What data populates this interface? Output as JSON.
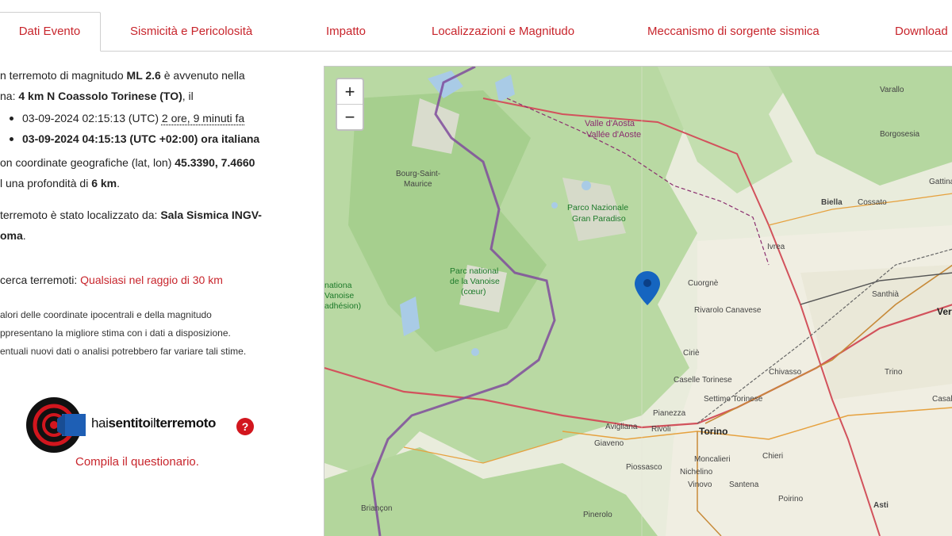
{
  "tabs": [
    {
      "label": "Dati Evento"
    },
    {
      "label": "Sismicità e Pericolosità"
    },
    {
      "label": "Impatto"
    },
    {
      "label": "Localizzazioni e Magnitudo"
    },
    {
      "label": "Meccanismo di sorgente sismica"
    },
    {
      "label": "Download"
    }
  ],
  "event": {
    "intro_pre": "n terremoto di magnitudo ",
    "magnitude": "ML 2.6",
    "intro_post": " è avvenuto nella",
    "zone_pre": "na: ",
    "zone": "4 km N Coassolo Torinese (TO)",
    "zone_post": ", il",
    "utc_time": "03-09-2024 02:15:13 (UTC)",
    "ago": "2 ore, 9 minuti fa",
    "local_time": "03-09-2024 04:15:13 (UTC +02:00) ora italiana",
    "coords_pre": "on coordinate geografiche (lat, lon) ",
    "coords": "45.3390, 7.4660",
    "depth_pre": "l una profondità di ",
    "depth": "6 km",
    "depth_post": ".",
    "located_pre": "terremoto è stato localizzato da: ",
    "located_by_1": "Sala Sismica INGV-",
    "located_by_2": "oma",
    "located_post": ".",
    "search_pre": "cerca terremoti: ",
    "search_link": "Qualsiasi nel raggio di 30 km",
    "note_1": "alori delle coordinate ipocentrali e della magnitudo",
    "note_2": "ppresentano la migliore stima con i dati a disposizione.",
    "note_3": "entuali nuovi dati o analisi potrebbero far variare tali stime."
  },
  "hsit": {
    "text_a": "hai",
    "text_b": "sentito",
    "text_c": "il",
    "text_d": "terremoto",
    "help": "?",
    "link": "Compila il questionario."
  },
  "map": {
    "zoom_in": "+",
    "zoom_out": "−",
    "labels": {
      "valle_aosta_1": "Valle d'Aosta",
      "valle_aosta_2": "Vallée d'Aoste",
      "varallo": "Varallo",
      "borgosesia": "Borgosesia",
      "bourg_1": "Bourg-Saint-",
      "bourg_2": "Maurice",
      "parco_1": "Parco Nazionale",
      "parco_2": "Gran Paradiso",
      "biella": "Biella",
      "cossato": "Cossato",
      "gattinara": "Gattinar",
      "ivrea": "Ivrea",
      "vanoise_1": "Parc national",
      "vanoise_2": "de la Vanoise",
      "vanoise_3": "(cœur)",
      "vanoise_adh_1": "nationa",
      "vanoise_adh_2": "Vanoise",
      "vanoise_adh_3": "adhésion)",
      "cuorgne": "Cuorgnè",
      "rivarolo": "Rivarolo Canavese",
      "santhia": "Santhià",
      "verc": "Ver",
      "cirie": "Ciriè",
      "chivasso": "Chivasso",
      "trino": "Trino",
      "caselle": "Caselle Torinese",
      "settimo": "Settimo Torinese",
      "casale": "Casale",
      "pianezza": "Pianezza",
      "avigliana": "Avigliana",
      "rivoli": "Rivoli",
      "torino": "Torino",
      "giaveno": "Giaveno",
      "chieri": "Chieri",
      "piossasco": "Piossasco",
      "moncalieri": "Moncalieri",
      "nichelino": "Nichelino",
      "vinovo": "Vinovo",
      "santena": "Santena",
      "poirino": "Poirino",
      "asti": "Asti",
      "briancon": "Briançon",
      "pinerolo": "Pinerolo"
    }
  },
  "colors": {
    "accent": "#c8252c",
    "marker": "#1565c0"
  }
}
